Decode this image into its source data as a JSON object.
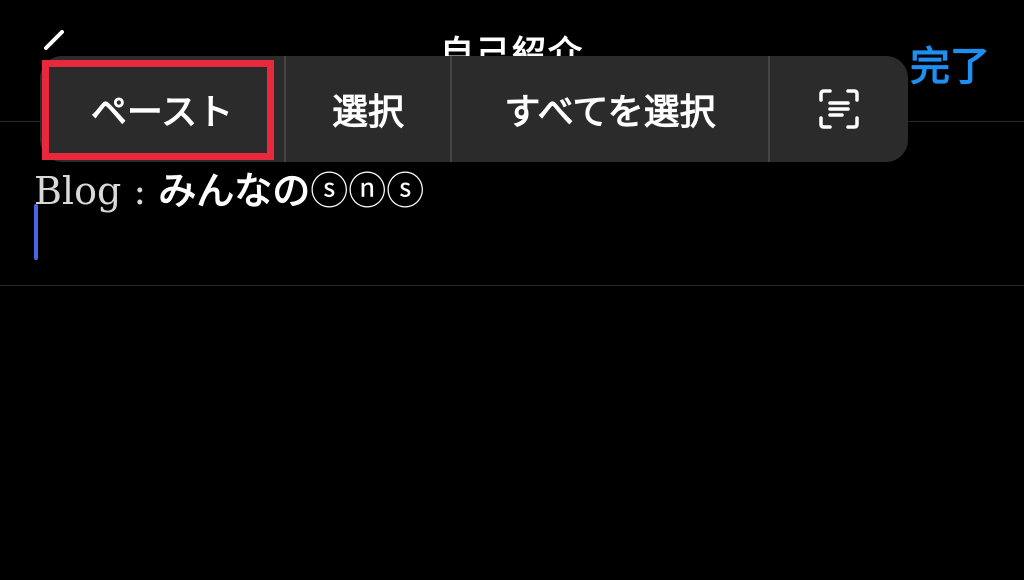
{
  "nav": {
    "title": "自己紹介",
    "done_label": "完了",
    "back_icon": "chevron-left-icon",
    "accent_color": "#1e8ff0"
  },
  "content": {
    "blog_label": "Blog :",
    "blog_name": "みんなの",
    "blog_suffix": "ⓢⓝⓢ"
  },
  "edit_menu": {
    "items": [
      {
        "label": "ペースト"
      },
      {
        "label": "選択"
      },
      {
        "label": "すべてを選択"
      },
      {
        "label": "",
        "icon": "scan-text-icon"
      }
    ]
  },
  "highlight": {
    "color": "#e8293d",
    "target": "ペースト"
  },
  "cursor_color": "#4a63e8"
}
